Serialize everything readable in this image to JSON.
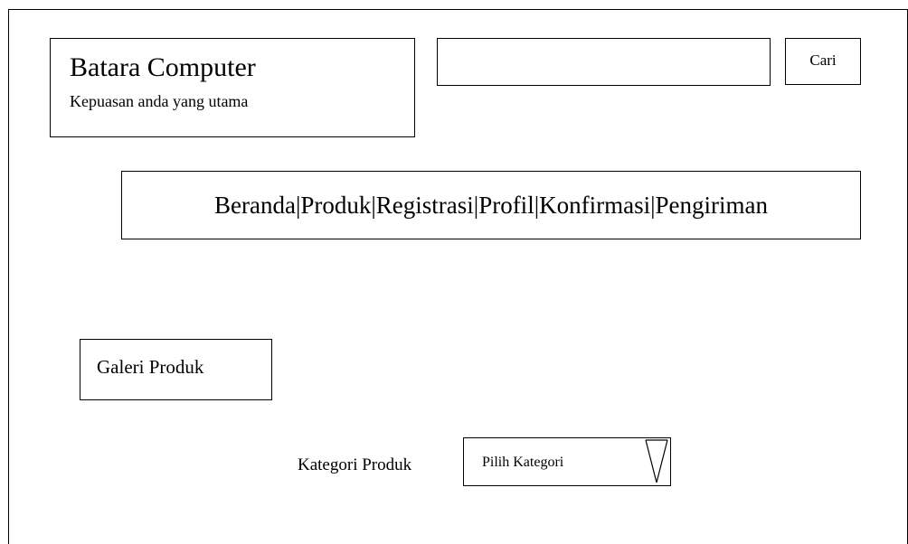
{
  "header": {
    "brand_title": "Batara Computer",
    "brand_tagline": "Kepuasan anda yang utama"
  },
  "search": {
    "value": "",
    "placeholder": "",
    "button_label": "Cari"
  },
  "nav": {
    "items": [
      "Beranda",
      "Produk",
      "Registrasi",
      "Profil",
      "Konfirmasi",
      "Pengiriman"
    ],
    "separator": "|"
  },
  "gallery": {
    "title": "Galeri Produk"
  },
  "category": {
    "label": "Kategori Produk",
    "selected": "Pilih Kategori",
    "icon": "triangle-down-icon"
  },
  "colors": {
    "line": "#000000",
    "background": "#ffffff"
  }
}
